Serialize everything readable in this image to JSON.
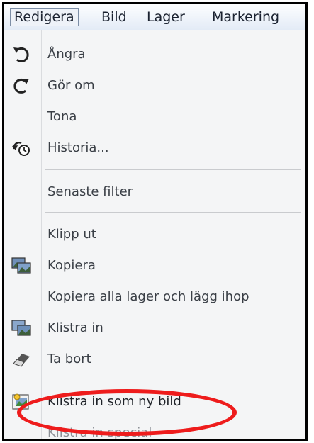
{
  "menubar": {
    "items": [
      {
        "label": "Redigera",
        "open": true
      },
      {
        "label": "Bild"
      },
      {
        "label": "Lager"
      },
      {
        "label": "Markering"
      }
    ]
  },
  "menu": {
    "items": [
      {
        "label": "Ångra",
        "icon": "undo-icon",
        "enabled": true
      },
      {
        "label": "Gör om",
        "icon": "redo-icon",
        "enabled": true
      },
      {
        "label": "Tona",
        "enabled": true
      },
      {
        "label": "Historia...",
        "icon": "history-icon",
        "enabled": true
      },
      {
        "label": "Senaste filter",
        "enabled": true
      },
      {
        "label": "Klipp ut",
        "enabled": true
      },
      {
        "label": "Kopiera",
        "icon": "copy-image-icon",
        "enabled": true
      },
      {
        "label": "Kopiera alla lager och lägg ihop",
        "enabled": true
      },
      {
        "label": "Klistra in",
        "icon": "paste-image-icon",
        "enabled": true
      },
      {
        "label": "Ta bort",
        "icon": "eraser-icon",
        "enabled": true
      },
      {
        "label": "Klistra in som ny bild",
        "icon": "paste-as-new-image-icon",
        "enabled": true,
        "circled": true
      },
      {
        "label": "Klistra in special",
        "enabled": false
      }
    ]
  },
  "colors": {
    "annotation": "#ee1c1c"
  }
}
